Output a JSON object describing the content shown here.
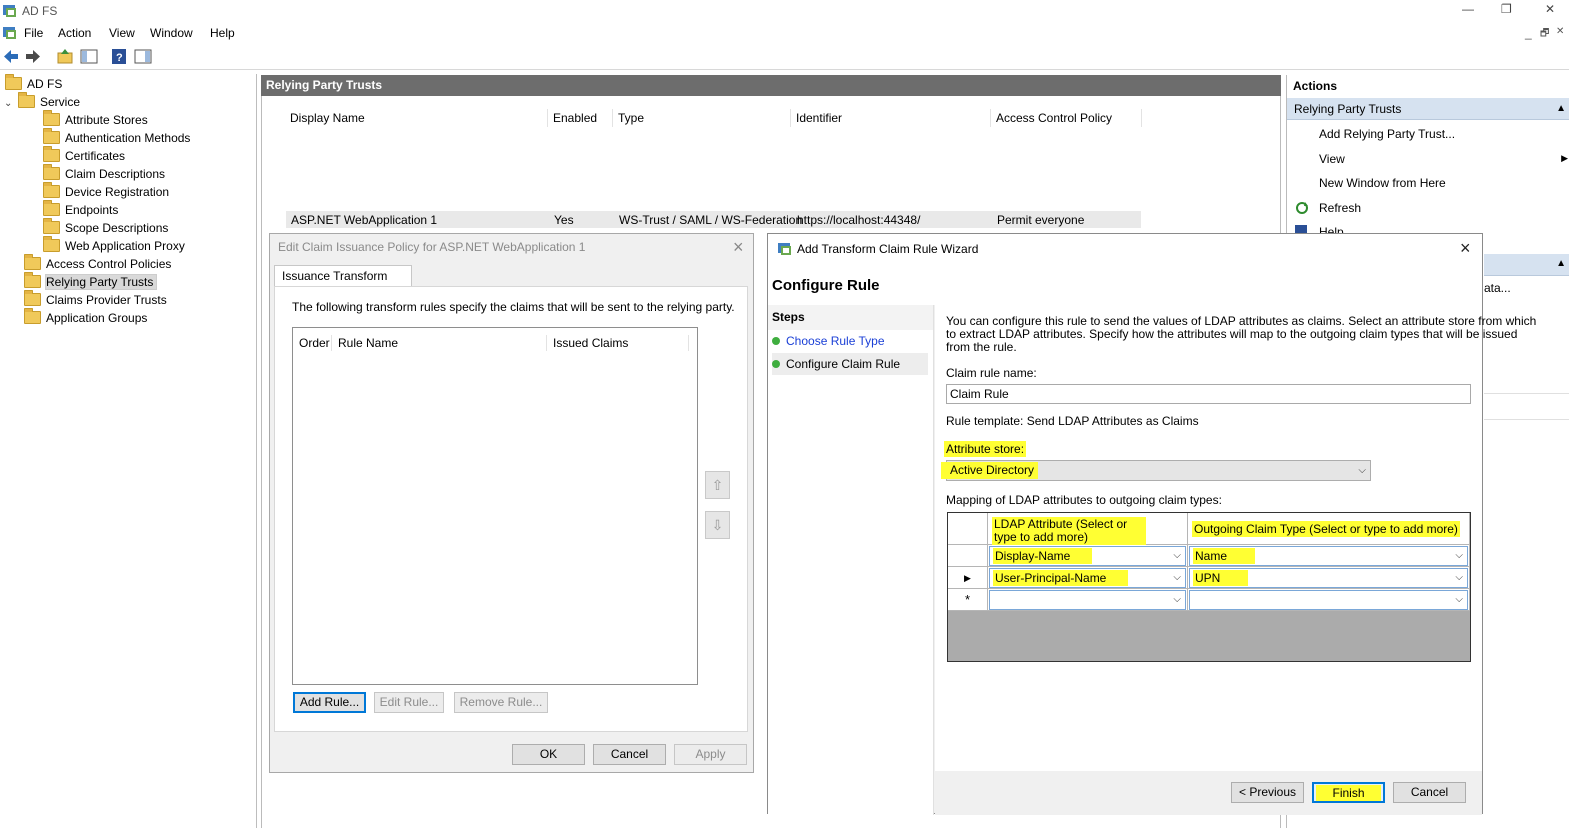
{
  "window": {
    "title": "AD FS",
    "controls": {
      "minimize": "—",
      "restore": "❐",
      "close": "✕"
    },
    "inner_controls": {
      "minimize": "_",
      "restore": "🗗",
      "close": "✕"
    }
  },
  "menu": [
    "File",
    "Action",
    "View",
    "Window",
    "Help"
  ],
  "toolbar": {
    "icons": [
      "back-arrow-icon",
      "forward-arrow-icon",
      "up-folder-icon",
      "show-hide-tree-icon",
      "help-icon",
      "show-hide-action-pane-icon"
    ]
  },
  "tree": {
    "root": "AD FS",
    "service": "Service",
    "service_children": [
      "Attribute Stores",
      "Authentication Methods",
      "Certificates",
      "Claim Descriptions",
      "Device Registration",
      "Endpoints",
      "Scope Descriptions",
      "Web Application Proxy"
    ],
    "siblings": [
      "Access Control Policies",
      "Relying Party Trusts",
      "Claims Provider Trusts",
      "Application Groups"
    ]
  },
  "center": {
    "header": "Relying Party Trusts",
    "columns": [
      "Display Name",
      "Enabled",
      "Type",
      "Identifier",
      "Access Control Policy"
    ],
    "row": {
      "display_name": "ASP.NET WebApplication 1",
      "enabled": "Yes",
      "type": "WS-Trust / SAML / WS-Federation",
      "identifier": "https://localhost:44348/",
      "policy": "Permit everyone"
    }
  },
  "actions": {
    "header": "Actions",
    "section": "Relying Party Trusts",
    "items": [
      "Add Relying Party Trust...",
      "View",
      "New Window from Here",
      "Refresh",
      "Help"
    ],
    "partial_text": "ata..."
  },
  "edit_dialog": {
    "title": "Edit Claim Issuance Policy for ASP.NET WebApplication 1",
    "tab": "Issuance Transform Rules",
    "description": "The following transform rules specify the claims that will be sent to the relying party.",
    "columns": [
      "Order",
      "Rule Name",
      "Issued Claims"
    ],
    "buttons": {
      "add": "Add Rule...",
      "edit": "Edit Rule...",
      "remove": "Remove Rule...",
      "ok": "OK",
      "cancel": "Cancel",
      "apply": "Apply"
    }
  },
  "wizard": {
    "title": "Add Transform Claim Rule Wizard",
    "heading": "Configure Rule",
    "steps_header": "Steps",
    "steps": [
      "Choose Rule Type",
      "Configure Claim Rule"
    ],
    "intro": [
      "You can configure this rule to send the values of LDAP attributes as claims. Select an attribute store from which",
      "to extract LDAP attributes. Specify how the attributes will map to the outgoing claim types that will be issued",
      "from the rule."
    ],
    "rule_name_label": "Claim rule name:",
    "rule_name_value": "Claim Rule",
    "template_label": "Rule template: Send LDAP Attributes as Claims",
    "store_label": "Attribute store:",
    "store_value": "Active Directory",
    "mapping_label": "Mapping of LDAP attributes to outgoing claim types:",
    "grid_headers": [
      "LDAP Attribute (Select or type to add more)",
      "Outgoing Claim Type (Select or type to add more)"
    ],
    "rows": [
      {
        "marker": "",
        "ldap": "Display-Name",
        "claim": "Name"
      },
      {
        "marker": "▶",
        "ldap": "User-Principal-Name",
        "claim": "UPN"
      },
      {
        "marker": "*",
        "ldap": "",
        "claim": ""
      }
    ],
    "buttons": {
      "previous": "< Previous",
      "finish": "Finish",
      "cancel": "Cancel"
    },
    "highlight_color": "#ffff33"
  }
}
